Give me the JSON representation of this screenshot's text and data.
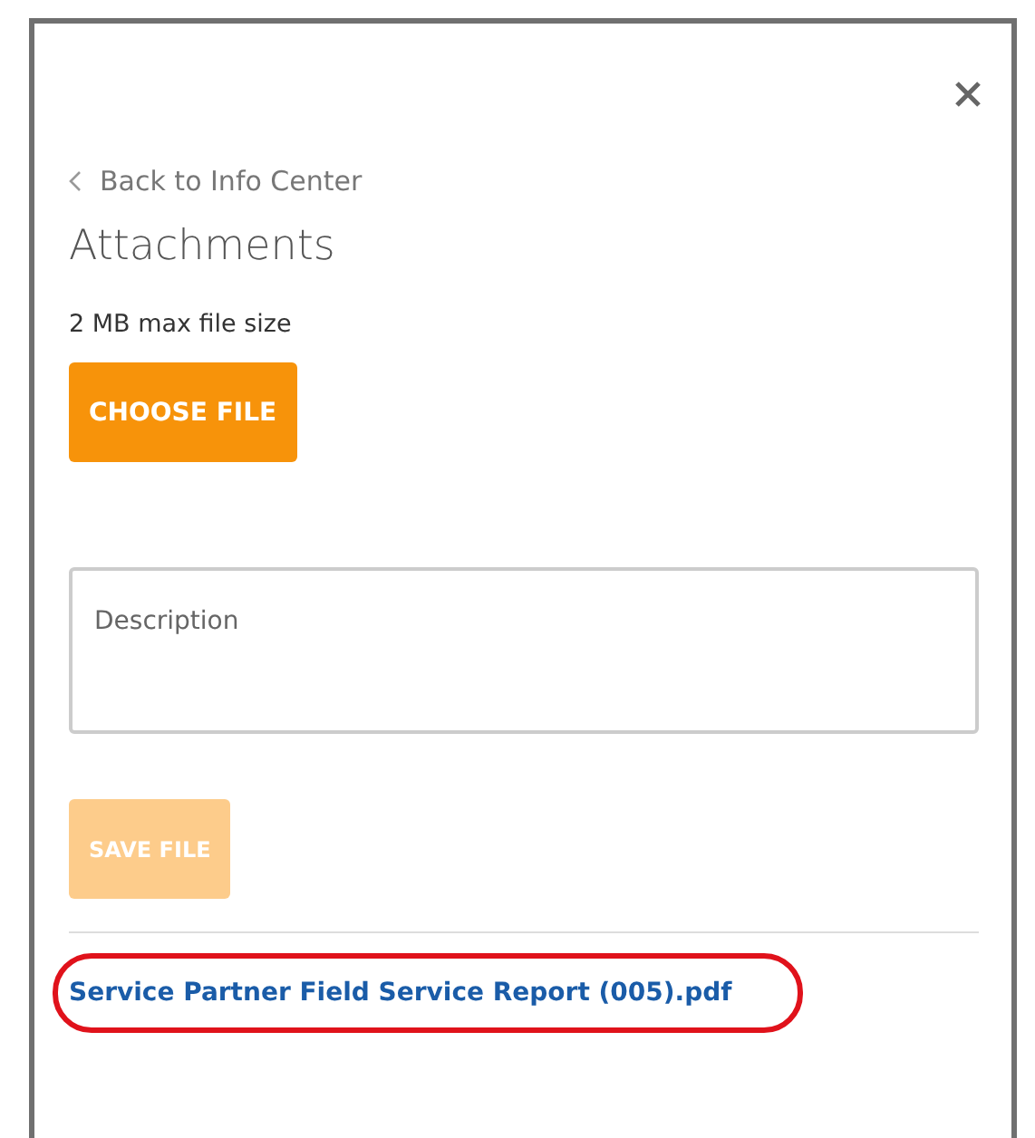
{
  "back_link": {
    "label": "Back to Info Center"
  },
  "title": "Attachments",
  "max_size_note": "2 MB max file size",
  "choose_button": {
    "label": "CHOOSE FILE",
    "disabled": false
  },
  "description_field": {
    "placeholder": "Description"
  },
  "save_button": {
    "label": "SAVE FILE",
    "disabled": true
  },
  "attachments": [
    {
      "name": "Service Partner Field Service Report (005).pdf",
      "highlighted": true
    }
  ]
}
